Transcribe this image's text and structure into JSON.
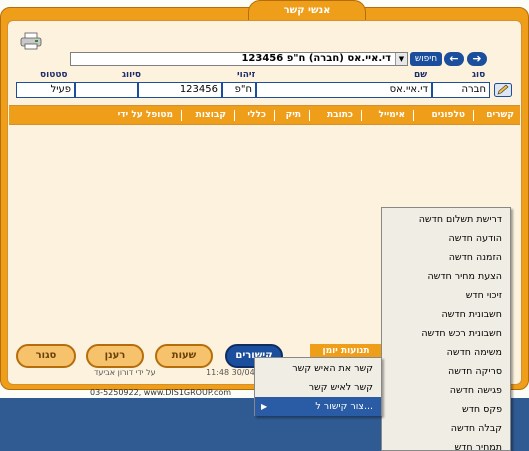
{
  "window": {
    "title": "אנשי קשר"
  },
  "toolbar": {
    "next_arrow": "➜",
    "prev_arrow": "←",
    "search_label": "חיפוש",
    "search_value": "די.איי.אס (חברה) ח\"פ 123456"
  },
  "record": {
    "headers": {
      "type": "סוג",
      "name": "שם",
      "id": "זיהוי",
      "classification": "סיווג",
      "status": "סטטוס"
    },
    "values": {
      "type": "חברה",
      "name": "די.איי.אס",
      "id_type": "ח\"פ",
      "id_number": "123456",
      "classification": "",
      "status": "פעיל"
    }
  },
  "tabs": [
    "קשרים",
    "טלפונים",
    "אימייל",
    "כתובת",
    "תיק",
    "כללי",
    "קבוצות",
    "מטופל על ידי"
  ],
  "bottom": {
    "journal_label": "תנועות יומן",
    "buttons": {
      "contacts": "קישורים",
      "hours": "שעות",
      "refresh": "רענן",
      "close": "סגור"
    },
    "footer_user": "על ידי דורון אביעד",
    "footer_time": "11:48 30/04/",
    "footer_company": "03-5250922, www.DIS1GROUP.com"
  },
  "context_menu": {
    "items": [
      "דרישת תשלום חדשה",
      "הודעה חדשה",
      "הזמנה חדשה",
      "הצעת מחיר חדשה",
      "זיכוי חדש",
      "חשבונית חדשה",
      "חשבונית רכש חדשה",
      "משימה חדשה",
      "סריקה חדשה",
      "פגישה חדשה",
      "פקס חדש",
      "קבלה חדשה",
      "תמחיר חדש"
    ]
  },
  "sub_menu": {
    "items": [
      "קשר את האיש קשר",
      "קשר לאיש קשר",
      "צור קישור ל..."
    ],
    "arrow": "▶"
  }
}
